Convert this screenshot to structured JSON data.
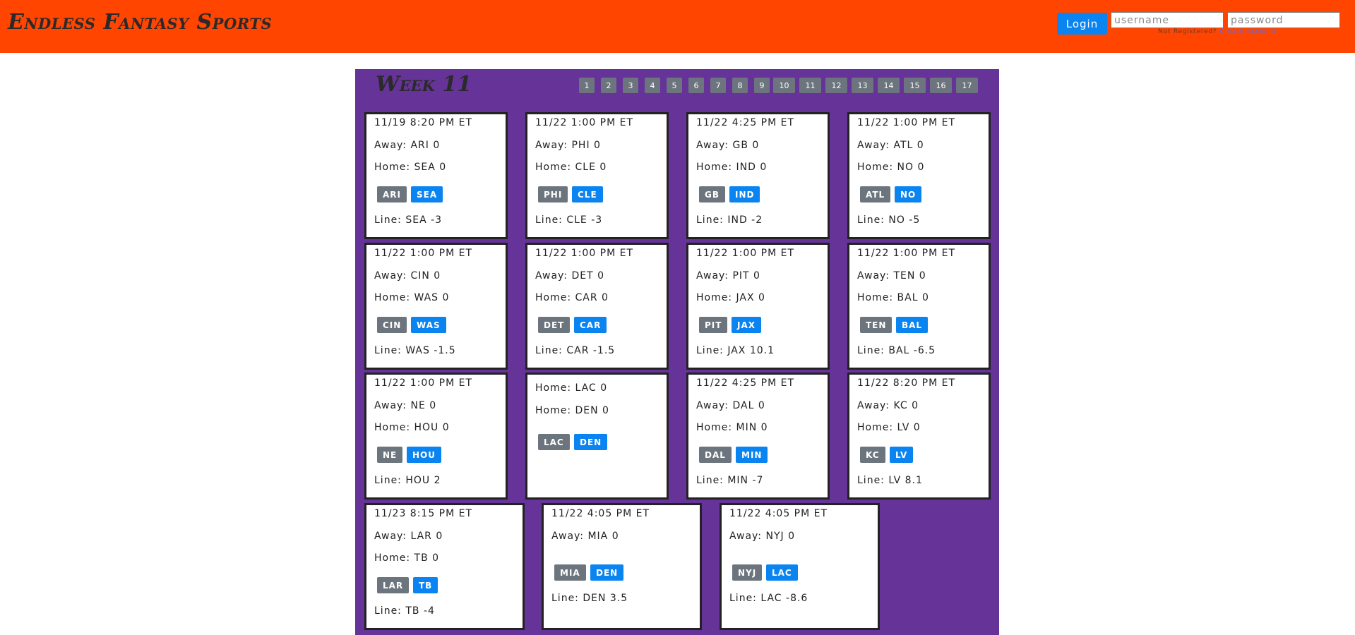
{
  "header": {
    "brand": "Endless Fantasy Sports",
    "login_label": "Login",
    "username_placeholder": "username",
    "password_placeholder": "password",
    "not_registered": "Not Registered?",
    "create_account": "Create Account"
  },
  "week": {
    "title": "Week 11",
    "pages": [
      "1",
      "2",
      "3",
      "4",
      "5",
      "6",
      "7",
      "8",
      "9",
      "10",
      "11",
      "12",
      "13",
      "14",
      "15",
      "16",
      "17"
    ]
  },
  "games": [
    {
      "time": "11/19 8:20 PM ET",
      "away": "Away: ARI 0",
      "home": "Home: SEA 0",
      "away_team": "ARI",
      "home_team": "SEA",
      "line": "Line: SEA -3"
    },
    {
      "time": "11/22 1:00 PM ET",
      "away": "Away: PHI 0",
      "home": "Home: CLE 0",
      "away_team": "PHI",
      "home_team": "CLE",
      "line": "Line: CLE -3"
    },
    {
      "time": "11/22 4:25 PM ET",
      "away": "Away: GB 0",
      "home": "Home: IND 0",
      "away_team": "GB",
      "home_team": "IND",
      "line": "Line: IND -2"
    },
    {
      "time": "11/22 1:00 PM ET",
      "away": "Away: ATL 0",
      "home": "Home: NO 0",
      "away_team": "ATL",
      "home_team": "NO",
      "line": "Line: NO -5"
    },
    {
      "time": "11/22 1:00 PM ET",
      "away": "Away: CIN 0",
      "home": "Home: WAS 0",
      "away_team": "CIN",
      "home_team": "WAS",
      "line": "Line: WAS -1.5"
    },
    {
      "time": "11/22 1:00 PM ET",
      "away": "Away: DET 0",
      "home": "Home: CAR 0",
      "away_team": "DET",
      "home_team": "CAR",
      "line": "Line: CAR -1.5"
    },
    {
      "time": "11/22 1:00 PM ET",
      "away": "Away: PIT 0",
      "home": "Home: JAX 0",
      "away_team": "PIT",
      "home_team": "JAX",
      "line": "Line: JAX 10.1"
    },
    {
      "time": "11/22 1:00 PM ET",
      "away": "Away: TEN 0",
      "home": "Home: BAL 0",
      "away_team": "TEN",
      "home_team": "BAL",
      "line": "Line: BAL -6.5"
    },
    {
      "time": "11/22 1:00 PM ET",
      "away": "Away: NE 0",
      "home": "Home: HOU 0",
      "away_team": "NE",
      "home_team": "HOU",
      "line": "Line: HOU 2"
    },
    {
      "time": "",
      "away": "Home: LAC 0",
      "home": "Home: DEN 0",
      "away_team": "LAC",
      "home_team": "DEN",
      "line": ""
    },
    {
      "time": "11/22 4:25 PM ET",
      "away": "Away: DAL 0",
      "home": "Home: MIN 0",
      "away_team": "DAL",
      "home_team": "MIN",
      "line": "Line: MIN -7"
    },
    {
      "time": "11/22 8:20 PM ET",
      "away": "Away: KC 0",
      "home": "Home: LV 0",
      "away_team": "KC",
      "home_team": "LV",
      "line": "Line: LV 8.1"
    },
    {
      "time": "11/23 8:15 PM ET",
      "away": "Away: LAR 0",
      "home": "Home: TB 0",
      "away_team": "LAR",
      "home_team": "TB",
      "line": "Line: TB -4"
    },
    {
      "time": "11/22 4:05 PM ET",
      "away": "Away: MIA 0",
      "home": "",
      "away_team": "MIA",
      "home_team": "DEN",
      "line": "Line: DEN 3.5"
    },
    {
      "time": "11/22 4:05 PM ET",
      "away": "Away: NYJ 0",
      "home": "",
      "away_team": "NYJ",
      "home_team": "LAC",
      "line": "Line: LAC -8.6"
    }
  ]
}
